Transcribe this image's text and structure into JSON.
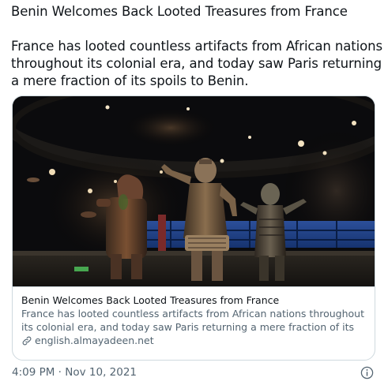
{
  "tweet": {
    "headline": "Benin Welcomes Back Looted Treasures from France",
    "body_lines": [
      "France has looted countless artifacts from African nations",
      "throughout its colonial era, and today saw Paris returning",
      "a mere fraction of its spoils to Benin."
    ]
  },
  "card": {
    "title": "Benin Welcomes Back Looted Treasures from France",
    "description": "France has looted countless artifacts from African nations throughout its colonial era, and today saw Paris returning a mere fraction of its spoils to",
    "domain": "english.almayadeen.net",
    "image_icon": "museum-statues-photo",
    "domain_icon": "link-icon"
  },
  "meta": {
    "timestamp": "4:09 PM · Nov 10, 2021",
    "info_icon": "info-icon"
  },
  "colors": {
    "text_primary": "#0f1419",
    "text_secondary": "#536471",
    "border": "#cfd9de"
  }
}
